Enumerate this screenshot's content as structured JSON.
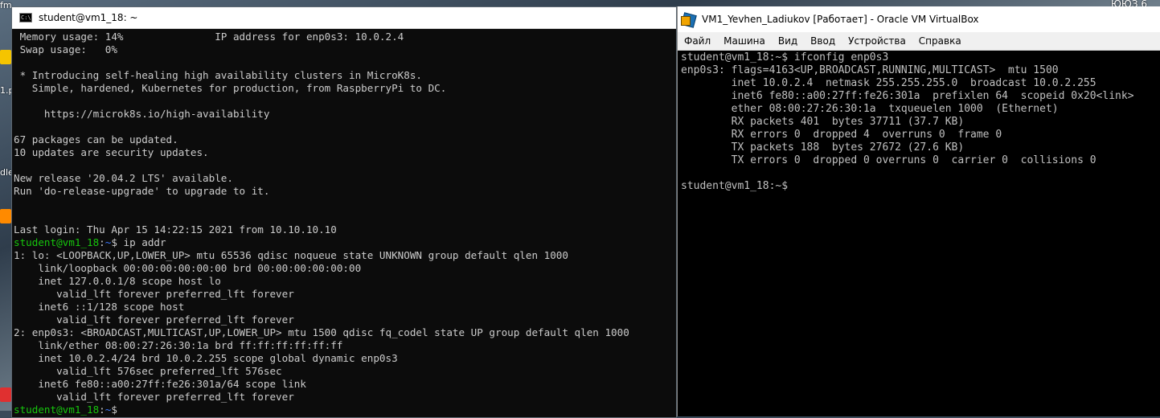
{
  "desktop": {
    "tray_text": "ЮЮЗ 6",
    "side_labels": [
      "fm",
      "1.p",
      "dle"
    ]
  },
  "left_window": {
    "title": "student@vm1_18: ~",
    "lines": [
      " Memory usage: 14%               IP address for enp0s3: 10.0.2.4",
      " Swap usage:   0%",
      "",
      " * Introducing self-healing high availability clusters in MicroK8s.",
      "   Simple, hardened, Kubernetes for production, from RaspberryPi to DC.",
      "",
      "     https://microk8s.io/high-availability",
      "",
      "67 packages can be updated.",
      "10 updates are security updates.",
      "",
      "New release '20.04.2 LTS' available.",
      "Run 'do-release-upgrade' to upgrade to it.",
      "",
      "",
      "Last login: Thu Apr 15 14:22:15 2021 from 10.10.10.10"
    ],
    "prompt_user": "student@vm1_18",
    "prompt_sep": ":",
    "prompt_path": "~",
    "prompt_suffix": "$ ",
    "command": "ip addr",
    "output": [
      "1: lo: <LOOPBACK,UP,LOWER_UP> mtu 65536 qdisc noqueue state UNKNOWN group default qlen 1000",
      "    link/loopback 00:00:00:00:00:00 brd 00:00:00:00:00:00",
      "    inet 127.0.0.1/8 scope host lo",
      "       valid_lft forever preferred_lft forever",
      "    inet6 ::1/128 scope host",
      "       valid_lft forever preferred_lft forever",
      "2: enp0s3: <BROADCAST,MULTICAST,UP,LOWER_UP> mtu 1500 qdisc fq_codel state UP group default qlen 1000",
      "    link/ether 08:00:27:26:30:1a brd ff:ff:ff:ff:ff:ff",
      "    inet 10.0.2.4/24 brd 10.0.2.255 scope global dynamic enp0s3",
      "       valid_lft 576sec preferred_lft 576sec",
      "    inet6 fe80::a00:27ff:fe26:301a/64 scope link",
      "       valid_lft forever preferred_lft forever"
    ],
    "final_prompt": "$"
  },
  "right_window": {
    "title": "VM1_Yevhen_Ladiukov [Работает] - Oracle VM VirtualBox",
    "menu": [
      "Файл",
      "Машина",
      "Вид",
      "Ввод",
      "Устройства",
      "Справка"
    ],
    "lines": [
      "student@vm1_18:~$ ifconfig enp0s3",
      "enp0s3: flags=4163<UP,BROADCAST,RUNNING,MULTICAST>  mtu 1500",
      "        inet 10.0.2.4  netmask 255.255.255.0  broadcast 10.0.2.255",
      "        inet6 fe80::a00:27ff:fe26:301a  prefixlen 64  scopeid 0x20<link>",
      "        ether 08:00:27:26:30:1a  txqueuelen 1000  (Ethernet)",
      "        RX packets 401  bytes 37711 (37.7 KB)",
      "        RX errors 0  dropped 4  overruns 0  frame 0",
      "        TX packets 188  bytes 27672 (27.6 KB)",
      "        TX errors 0  dropped 0 overruns 0  carrier 0  collisions 0",
      "",
      "student@vm1_18:~$"
    ]
  },
  "colors": {
    "prompt_user": "#16c60c",
    "prompt_path": "#3b78ff",
    "terminal_text": "#cccccc",
    "terminal_bg": "#0c0c0c"
  }
}
